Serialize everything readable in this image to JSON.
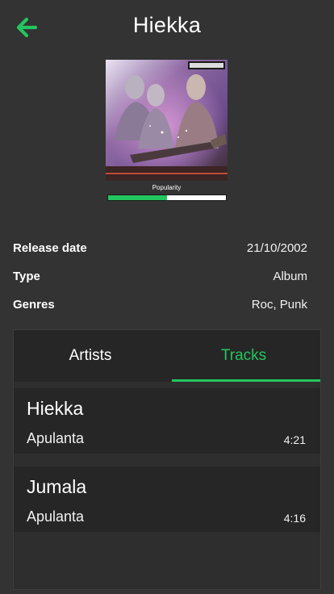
{
  "header": {
    "title": "Hiekka",
    "back_icon": "arrow-left-icon",
    "accent_color": "#23c55e"
  },
  "album": {
    "popularity_label": "Popularity",
    "popularity_fraction": 0.5
  },
  "meta": {
    "release_date_label": "Release date",
    "release_date_value": "21/10/2002",
    "type_label": "Type",
    "type_value": "Album",
    "genres_label": "Genres",
    "genres_value": "Roc, Punk"
  },
  "tabs": {
    "items": [
      {
        "label": "Artists",
        "active": false
      },
      {
        "label": "Tracks",
        "active": true
      }
    ]
  },
  "tracks": [
    {
      "name": "Hiekka",
      "artist": "Apulanta",
      "duration": "4:21"
    },
    {
      "name": "Jumala",
      "artist": "Apulanta",
      "duration": "4:16"
    }
  ]
}
